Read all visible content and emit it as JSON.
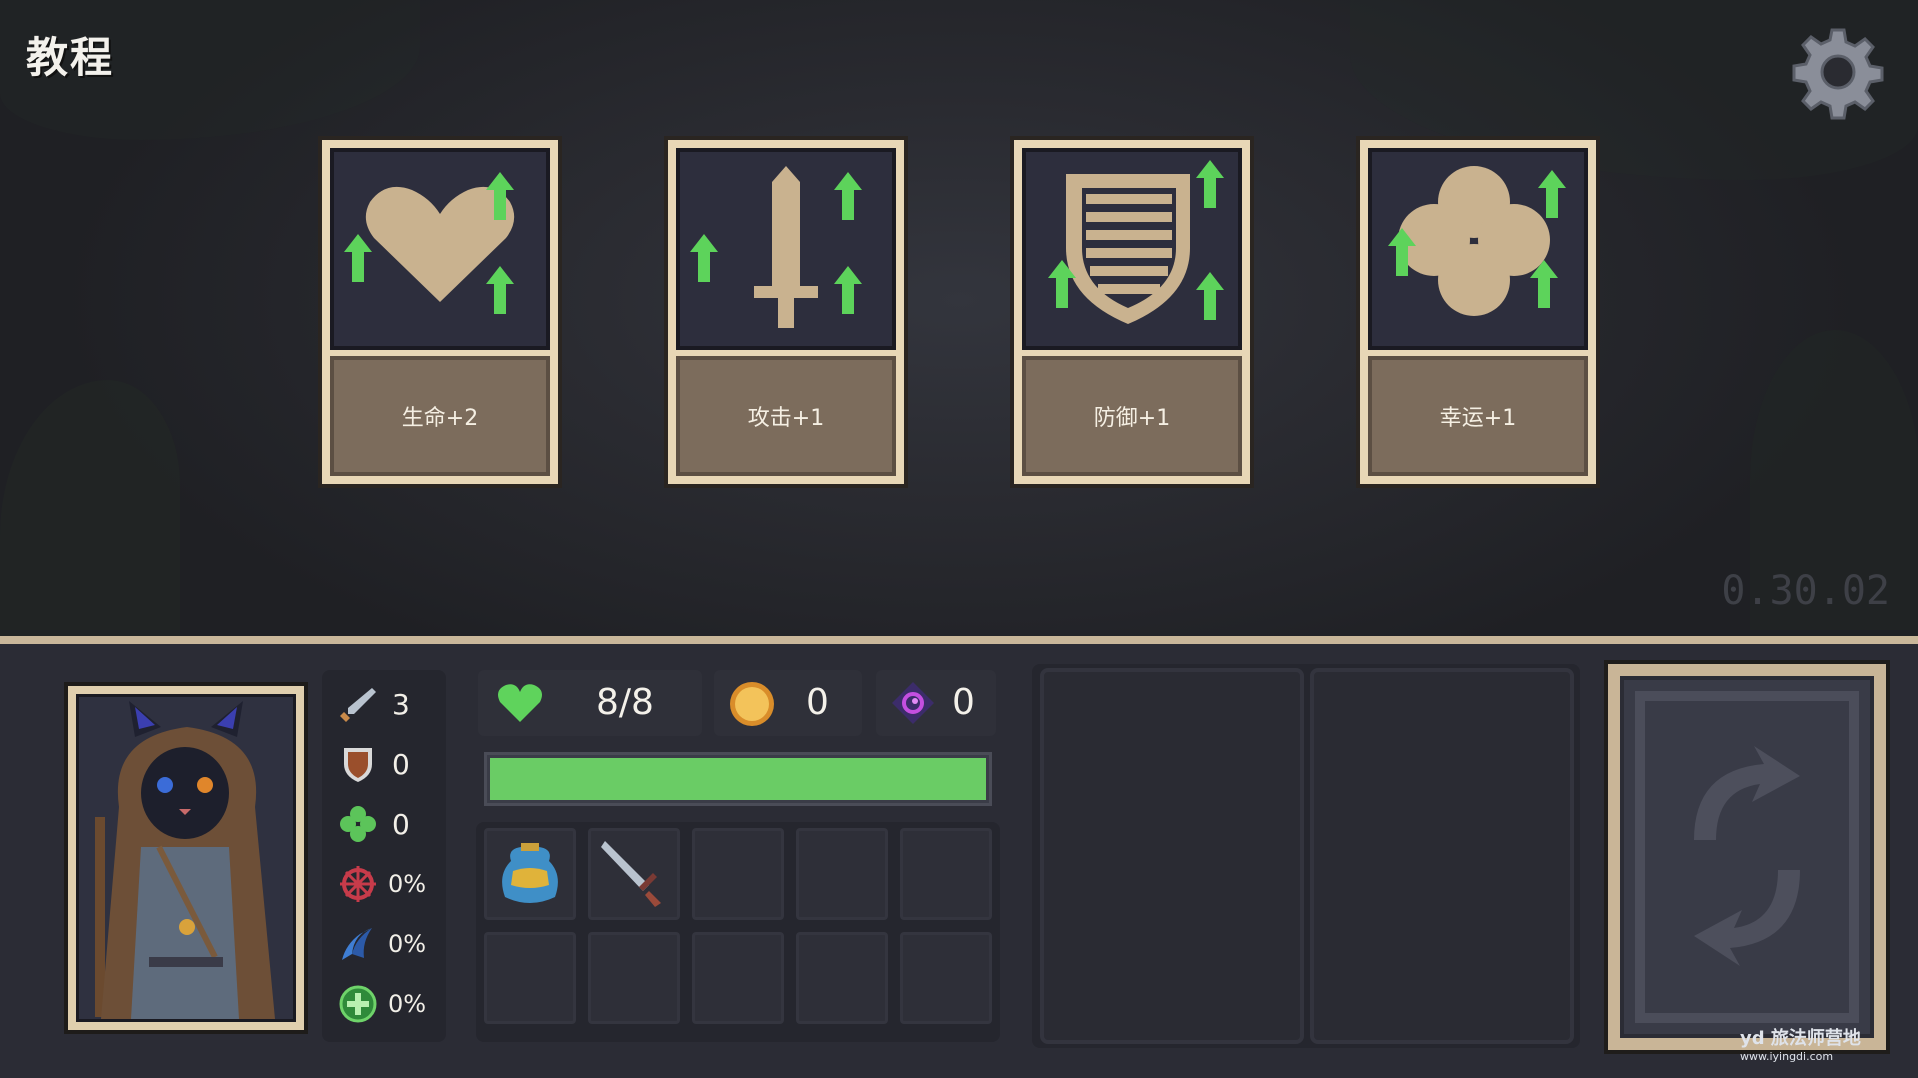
{
  "header": {
    "title": "教程",
    "version": "0.30.02"
  },
  "settings": {
    "icon": "gear-icon"
  },
  "cards": [
    {
      "label": "生命+2",
      "icon": "heart-icon"
    },
    {
      "label": "攻击+1",
      "icon": "sword-icon"
    },
    {
      "label": "防御+1",
      "icon": "shield-icon"
    },
    {
      "label": "幸运+1",
      "icon": "clover-icon"
    }
  ],
  "stats": {
    "attack": "3",
    "defense": "0",
    "luck": "0",
    "crit": "0%",
    "dodge": "0%",
    "heal": "0%"
  },
  "resources": {
    "health": "8/8",
    "gold": "0",
    "soul": "0"
  },
  "health_bar": {
    "fraction": 1.0
  },
  "inventory": {
    "items": [
      "pouch-icon",
      "dagger-icon"
    ],
    "slot_count": 10
  },
  "colors": {
    "card_frame": "#e8d7b6",
    "card_label": "#7c6c5c",
    "art_bg": "#2d2e3d",
    "art_icon": "#c9b28f",
    "arrow": "#5dd35b",
    "health_green": "#6acc65",
    "hud_bg": "#2b2c35"
  }
}
